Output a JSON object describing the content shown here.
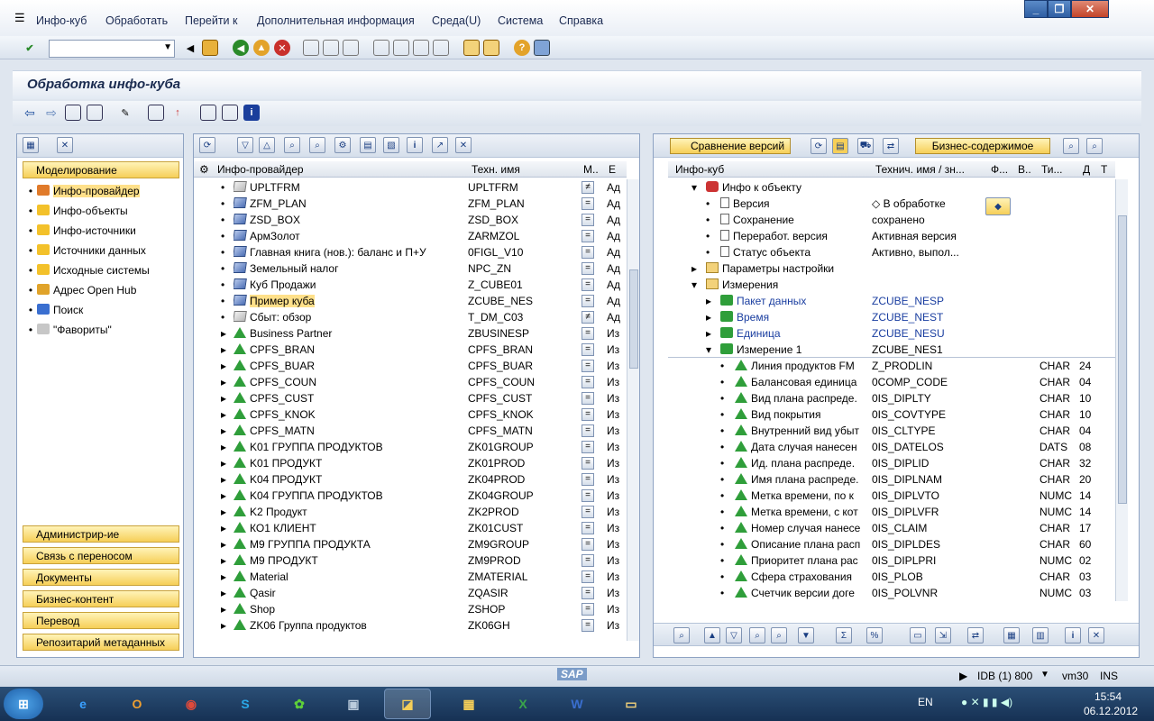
{
  "menubar": {
    "items": [
      "Инфо-куб",
      "Обработать",
      "Перейти к",
      "Дополнительная информация",
      "Среда(U)",
      "Система",
      "Справка"
    ]
  },
  "title": "Обработка инфо-куба",
  "left_nav": {
    "header": "Моделирование",
    "items": [
      "Инфо-провайдер",
      "Инфо-объекты",
      "Инфо-источники",
      "Источники данных",
      "Исходные системы",
      "Адрес Open Hub",
      "Поиск",
      "\"Фавориты\""
    ],
    "bottom": [
      "Администрир-ие",
      "Связь с переносом",
      "Документы",
      "Бизнес-контент",
      "Перевод",
      "Репозитарий метаданных"
    ]
  },
  "center": {
    "headers": [
      "Инфо-провайдер",
      "Техн. имя",
      "М..",
      "Е"
    ],
    "rows": [
      {
        "name": "UPLTFRM",
        "tech": "UPLTFRM",
        "e": "Ад",
        "icon": "cube-gray",
        "st": "≠"
      },
      {
        "name": "ZFM_PLAN",
        "tech": "ZFM_PLAN",
        "e": "Ад",
        "icon": "cube",
        "st": "="
      },
      {
        "name": "ZSD_BOX",
        "tech": "ZSD_BOX",
        "e": "Ад",
        "icon": "cube",
        "st": "="
      },
      {
        "name": "АрмЗолот",
        "tech": "ZARMZOL",
        "e": "Ад",
        "icon": "cube",
        "st": "="
      },
      {
        "name": "Главная книга (нов.): баланс и П+У",
        "tech": "0FIGL_V10",
        "e": "Ад",
        "icon": "cube",
        "st": "="
      },
      {
        "name": "Земельный налог",
        "tech": "NPC_ZN",
        "e": "Ад",
        "icon": "cube",
        "st": "="
      },
      {
        "name": "Куб Продажи",
        "tech": "Z_CUBE01",
        "e": "Ад",
        "icon": "cube",
        "st": "="
      },
      {
        "name": "Пример куба",
        "tech": "ZCUBE_NES",
        "e": "Ад",
        "icon": "cube",
        "st": "=",
        "selected": true
      },
      {
        "name": "Сбыт: обзор",
        "tech": "T_DM_C03",
        "e": "Ад",
        "icon": "cube-gray",
        "st": "≠"
      },
      {
        "name": "Business Partner",
        "tech": "ZBUSINESP",
        "e": "Из",
        "icon": "pyr",
        "st": "="
      },
      {
        "name": "CPFS_BRAN",
        "tech": "CPFS_BRAN",
        "e": "Из",
        "icon": "pyr",
        "st": "="
      },
      {
        "name": "CPFS_BUAR",
        "tech": "CPFS_BUAR",
        "e": "Из",
        "icon": "pyr",
        "st": "="
      },
      {
        "name": "CPFS_COUN",
        "tech": "CPFS_COUN",
        "e": "Из",
        "icon": "pyr",
        "st": "="
      },
      {
        "name": "CPFS_CUST",
        "tech": "CPFS_CUST",
        "e": "Из",
        "icon": "pyr",
        "st": "="
      },
      {
        "name": "CPFS_KNOK",
        "tech": "CPFS_KNOK",
        "e": "Из",
        "icon": "pyr",
        "st": "="
      },
      {
        "name": "CPFS_MATN",
        "tech": "CPFS_MATN",
        "e": "Из",
        "icon": "pyr",
        "st": "="
      },
      {
        "name": "K01 ГРУППА ПРОДУКТОВ",
        "tech": "ZK01GROUP",
        "e": "Из",
        "icon": "pyr",
        "st": "="
      },
      {
        "name": "K01 ПРОДУКТ",
        "tech": "ZK01PROD",
        "e": "Из",
        "icon": "pyr",
        "st": "="
      },
      {
        "name": "K04  ПРОДУКТ",
        "tech": "ZK04PROD",
        "e": "Из",
        "icon": "pyr",
        "st": "="
      },
      {
        "name": "K04 ГРУППА ПРОДУКТОВ",
        "tech": "ZK04GROUP",
        "e": "Из",
        "icon": "pyr",
        "st": "="
      },
      {
        "name": "K2 Продукт",
        "tech": "ZK2PROD",
        "e": "Из",
        "icon": "pyr",
        "st": "="
      },
      {
        "name": "КО1 КЛИЕНТ",
        "tech": "ZK01CUST",
        "e": "Из",
        "icon": "pyr",
        "st": "="
      },
      {
        "name": "М9 ГРУППА ПРОДУКТА",
        "tech": "ZM9GROUP",
        "e": "Из",
        "icon": "pyr",
        "st": "="
      },
      {
        "name": "М9 ПРОДУКТ",
        "tech": "ZM9PROD",
        "e": "Из",
        "icon": "pyr",
        "st": "="
      },
      {
        "name": "Material",
        "tech": "ZMATERIAL",
        "e": "Из",
        "icon": "pyr",
        "st": "="
      },
      {
        "name": "Qasir",
        "tech": "ZQASIR",
        "e": "Из",
        "icon": "pyr",
        "st": "="
      },
      {
        "name": "Shop",
        "tech": "ZSHOP",
        "e": "Из",
        "icon": "pyr",
        "st": "="
      },
      {
        "name": "ZK06 Группа продуктов",
        "tech": "ZK06GH",
        "e": "Из",
        "icon": "pyr",
        "st": "="
      }
    ]
  },
  "right": {
    "buttons": {
      "compare": "Сравнение версий",
      "business": "Бизнес-содержимое"
    },
    "headers": [
      "Инфо-куб",
      "Технич. имя / зн...",
      "Ф...",
      "В..",
      "Ти...",
      "Д",
      "Т"
    ],
    "rows": [
      {
        "lvl": 2,
        "exp": "▾",
        "icon": "info",
        "name": "Инфо к объекту",
        "val": ""
      },
      {
        "lvl": 3,
        "exp": "•",
        "icon": "doc",
        "name": "Версия",
        "val": "◇ В обработке"
      },
      {
        "lvl": 3,
        "exp": "•",
        "icon": "doc",
        "name": "Сохранение",
        "val": "сохранено"
      },
      {
        "lvl": 3,
        "exp": "•",
        "icon": "doc",
        "name": "Переработ. версия",
        "val": "Активная версия"
      },
      {
        "lvl": 3,
        "exp": "•",
        "icon": "doc",
        "name": "Статус объекта",
        "val": "Активно, выпол..."
      },
      {
        "lvl": 2,
        "exp": "▸",
        "icon": "folder",
        "name": "Параметры настройки",
        "val": ""
      },
      {
        "lvl": 2,
        "exp": "▾",
        "icon": "folder",
        "name": "Измерения",
        "val": ""
      },
      {
        "lvl": 3,
        "exp": "▸",
        "icon": "dim",
        "name": "Пакет данных",
        "val": "ZCUBE_NESP",
        "link": true
      },
      {
        "lvl": 3,
        "exp": "▸",
        "icon": "dim",
        "name": "Время",
        "val": "ZCUBE_NEST",
        "link": true
      },
      {
        "lvl": 3,
        "exp": "▸",
        "icon": "dim",
        "name": "Единица",
        "val": "ZCUBE_NESU",
        "link": true
      },
      {
        "lvl": 3,
        "exp": "▾",
        "icon": "dim",
        "name": "Измерение 1",
        "val": "ZCUBE_NES1"
      },
      {
        "lvl": 4,
        "exp": "•",
        "icon": "pyr",
        "name": "Линия продуктов FM",
        "val": "Z_PRODLIN",
        "type": "CHAR",
        "len": "24"
      },
      {
        "lvl": 4,
        "exp": "•",
        "icon": "pyr",
        "name": "Балансовая единица",
        "val": "0COMP_CODE",
        "type": "CHAR",
        "len": "04"
      },
      {
        "lvl": 4,
        "exp": "•",
        "icon": "pyr",
        "name": "Вид плана распреде.",
        "val": "0IS_DIPLTY",
        "type": "CHAR",
        "len": "10"
      },
      {
        "lvl": 4,
        "exp": "•",
        "icon": "pyr",
        "name": "Вид покрытия",
        "val": "0IS_COVTYPE",
        "type": "CHAR",
        "len": "10"
      },
      {
        "lvl": 4,
        "exp": "•",
        "icon": "pyr",
        "name": "Внутренний вид убыт",
        "val": "0IS_CLTYPE",
        "type": "CHAR",
        "len": "04"
      },
      {
        "lvl": 4,
        "exp": "•",
        "icon": "pyr",
        "name": "Дата случая нанесен",
        "val": "0IS_DATELOS",
        "type": "DATS",
        "len": "08"
      },
      {
        "lvl": 4,
        "exp": "•",
        "icon": "pyr",
        "name": "Ид. плана распреде.",
        "val": "0IS_DIPLID",
        "type": "CHAR",
        "len": "32"
      },
      {
        "lvl": 4,
        "exp": "•",
        "icon": "pyr",
        "name": "Имя плана распреде.",
        "val": "0IS_DIPLNAM",
        "type": "CHAR",
        "len": "20"
      },
      {
        "lvl": 4,
        "exp": "•",
        "icon": "pyr",
        "name": "Метка времени, по к",
        "val": "0IS_DIPLVTO",
        "type": "NUMC",
        "len": "14"
      },
      {
        "lvl": 4,
        "exp": "•",
        "icon": "pyr",
        "name": "Метка времени, с кот",
        "val": "0IS_DIPLVFR",
        "type": "NUMC",
        "len": "14"
      },
      {
        "lvl": 4,
        "exp": "•",
        "icon": "pyr",
        "name": "Номер случая нанесе",
        "val": "0IS_CLAIM",
        "type": "CHAR",
        "len": "17"
      },
      {
        "lvl": 4,
        "exp": "•",
        "icon": "pyr",
        "name": "Описание плана расп",
        "val": "0IS_DIPLDES",
        "type": "CHAR",
        "len": "60"
      },
      {
        "lvl": 4,
        "exp": "•",
        "icon": "pyr",
        "name": "Приоритет плана рас",
        "val": "0IS_DIPLPRI",
        "type": "NUMC",
        "len": "02"
      },
      {
        "lvl": 4,
        "exp": "•",
        "icon": "pyr",
        "name": "Сфера страхования",
        "val": "0IS_PLOB",
        "type": "CHAR",
        "len": "03"
      },
      {
        "lvl": 4,
        "exp": "•",
        "icon": "pyr",
        "name": "Счетчик версии доге",
        "val": "0IS_POLVNR",
        "type": "NUMC",
        "len": "03"
      }
    ]
  },
  "status": {
    "system": "IDB (1) 800",
    "server": "vm30",
    "mode": "INS",
    "logo": "SAP"
  },
  "taskbar": {
    "lang": "EN",
    "time": "15:54",
    "date": "06.12.2012"
  },
  "colors": {
    "accent": "#f6cf58",
    "selected": "#ffe08a",
    "link": "#1a3ea0",
    "tree_green": "#2f9e3a"
  }
}
